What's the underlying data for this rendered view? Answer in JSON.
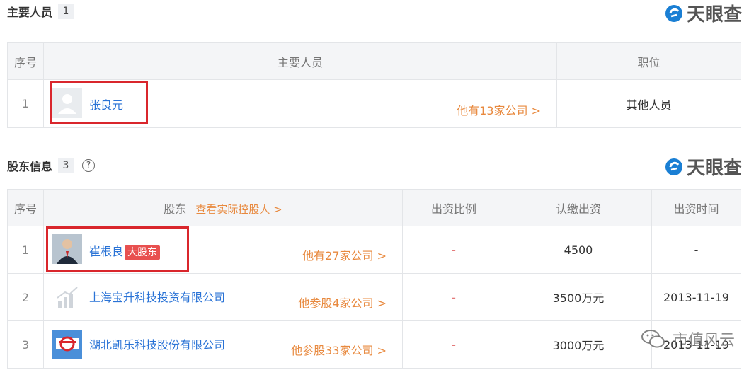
{
  "personnel": {
    "title": "主要人员",
    "count": "1",
    "brand": "天眼查",
    "headers": {
      "index": "序号",
      "person": "主要人员",
      "position": "职位"
    },
    "rows": [
      {
        "index": "1",
        "name": "张良元",
        "companies": "他有13家公司 >",
        "position": "其他人员"
      }
    ]
  },
  "shareholders": {
    "title": "股东信息",
    "count": "3",
    "help": "?",
    "brand": "天眼查",
    "headers": {
      "index": "序号",
      "holder": "股东",
      "controller_link": "查看实际控股人 >",
      "ratio": "出资比例",
      "subscribed": "认缴出资",
      "time": "出资时间"
    },
    "rows": [
      {
        "index": "1",
        "name": "崔根良",
        "tag": "大股东",
        "companies": "他有27家公司 >",
        "ratio": "-",
        "subscribed": "4500",
        "time": "-"
      },
      {
        "index": "2",
        "name": "上海宝升科技投资有限公司",
        "companies": "他参股4家公司 >",
        "ratio": "-",
        "subscribed": "3500万元",
        "time": "2013-11-19"
      },
      {
        "index": "3",
        "name": "湖北凯乐科技股份有限公司",
        "companies": "他参股33家公司 >",
        "ratio": "-",
        "subscribed": "3000万元",
        "time": "2013-11-19"
      }
    ]
  },
  "watermark": {
    "text": "市值风云"
  },
  "colors": {
    "orange": "#e8893e",
    "blue": "#2a73d6",
    "red_box": "#d9262c",
    "tag": "#e8504f"
  }
}
